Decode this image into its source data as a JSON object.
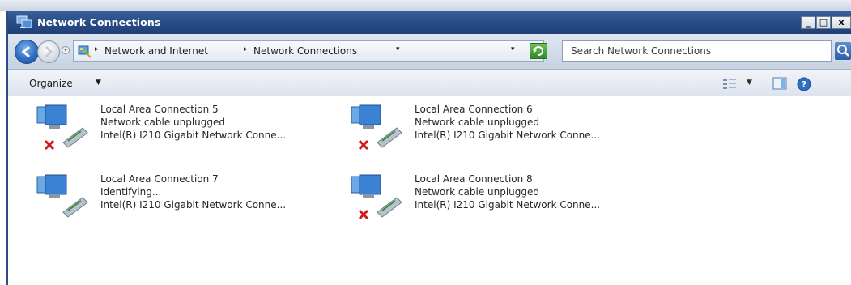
{
  "window": {
    "title": "Network Connections",
    "controls": {
      "minimize": "_",
      "maximize": "□",
      "close": "x"
    }
  },
  "address_bar": {
    "breadcrumbs": [
      "Network and Internet",
      "Network Connections"
    ],
    "search_placeholder": "Search Network Connections"
  },
  "toolbar": {
    "organize_label": "Organize"
  },
  "connections": [
    {
      "name": "Local Area Connection 5",
      "status": "Network cable unplugged",
      "adapter": "Intel(R) I210 Gigabit Network Conne...",
      "disconnected": true
    },
    {
      "name": "Local Area Connection 6",
      "status": "Network cable unplugged",
      "adapter": "Intel(R) I210 Gigabit Network Conne...",
      "disconnected": true
    },
    {
      "name": "Local Area Connection 7",
      "status": "Identifying...",
      "adapter": "Intel(R) I210 Gigabit Network Conne...",
      "disconnected": false
    },
    {
      "name": "Local Area Connection 8",
      "status": "Network cable unplugged",
      "adapter": "Intel(R) I210 Gigabit Network Conne...",
      "disconnected": true
    }
  ],
  "colors": {
    "titlebar": "#2a4d86",
    "error_x": "#d21a1a"
  },
  "icons": {
    "nav_back": "back-arrow-icon",
    "nav_forward": "forward-arrow-icon",
    "refresh": "refresh-icon",
    "search": "search-icon",
    "views": "views-icon",
    "preview": "preview-pane-icon",
    "help": "help-icon",
    "connection": "network-adapter-icon",
    "error": "red-x-icon"
  }
}
